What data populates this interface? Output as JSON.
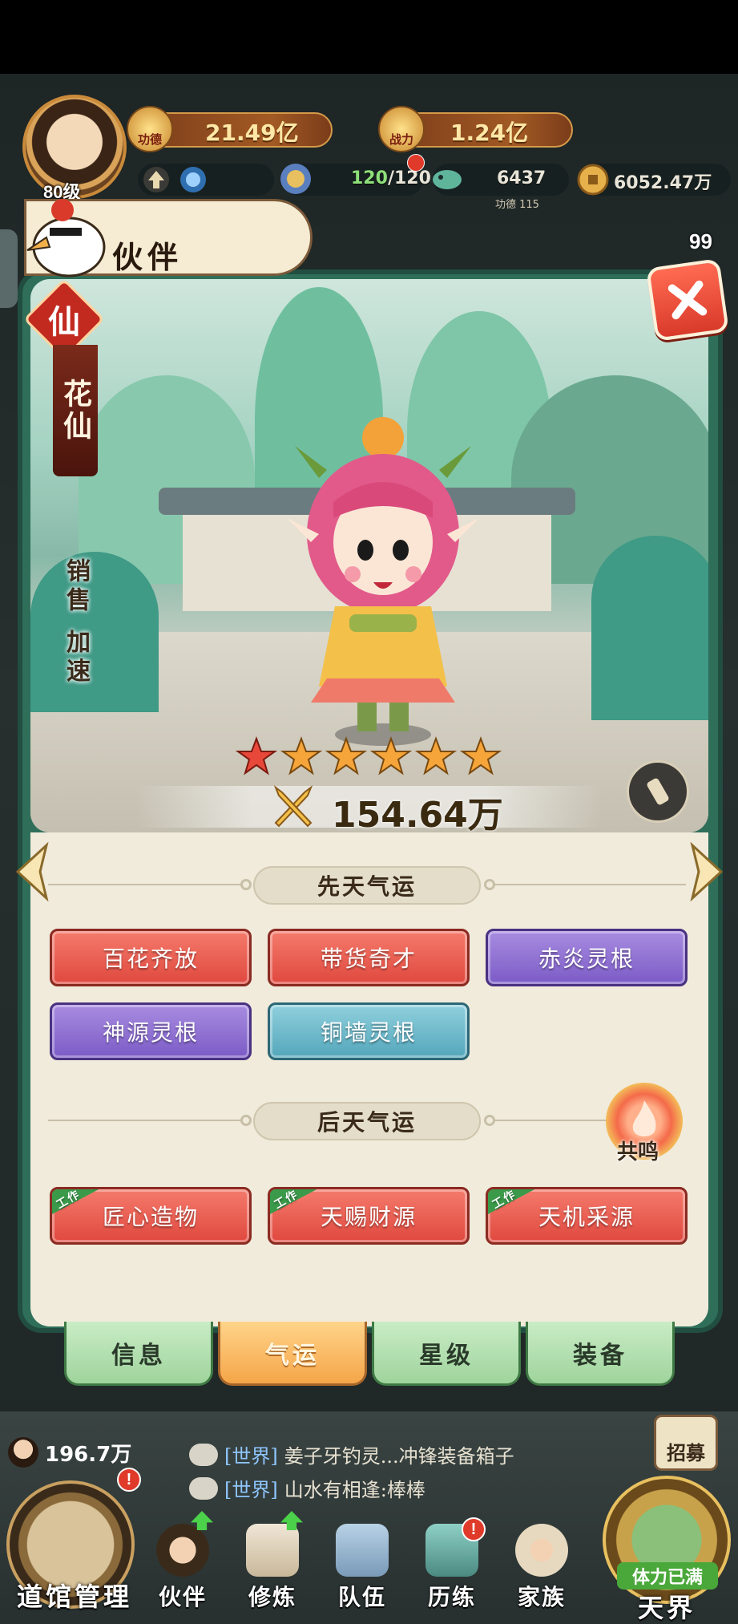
{
  "hud": {
    "level": "80级",
    "merit_label": "功德",
    "merit_value": "21.49亿",
    "power_label": "战力",
    "power_value": "1.24亿",
    "energy_value": "120",
    "energy_max": "/120",
    "jade_value": "6437",
    "merit_sub": "功德 115",
    "coin_value": "6052.47万",
    "badge_count": "99"
  },
  "header": {
    "title": "伙伴"
  },
  "partner": {
    "rank": "仙",
    "name": "花仙",
    "skill_vertical": "销售 加速",
    "stars": 6,
    "power": "154.64万"
  },
  "innate_fate": {
    "title": "先天气运",
    "items": [
      {
        "label": "百花齐放",
        "color": "red"
      },
      {
        "label": "带货奇才",
        "color": "red"
      },
      {
        "label": "赤炎灵根",
        "color": "purple"
      },
      {
        "label": "神源灵根",
        "color": "purple"
      },
      {
        "label": "铜墙灵根",
        "color": "teal"
      }
    ]
  },
  "acquired_fate": {
    "title": "后天气运",
    "resonance": "共鸣",
    "work_tag": "工作",
    "items": [
      {
        "label": "匠心造物"
      },
      {
        "label": "天赐财源"
      },
      {
        "label": "天机采源"
      }
    ]
  },
  "tabs": [
    {
      "label": "信息",
      "active": false
    },
    {
      "label": "气运",
      "active": true
    },
    {
      "label": "星级",
      "active": false
    },
    {
      "label": "装备",
      "active": false
    }
  ],
  "bottom": {
    "currency": "196.7万",
    "chat": [
      {
        "channel": "[世界]",
        "text": "姜子牙钓灵...冲锋装备箱子"
      },
      {
        "channel": "[世界]",
        "text": "山水有相逢:棒棒"
      }
    ],
    "recruit": "招募",
    "left_big": "道馆管理",
    "nav": [
      {
        "label": "伙伴"
      },
      {
        "label": "修炼"
      },
      {
        "label": "队伍"
      },
      {
        "label": "历练"
      },
      {
        "label": "家族"
      }
    ],
    "stamina": "体力已满",
    "right_big": "天界"
  },
  "colors": {
    "fate_red": "#e0483e",
    "fate_purple": "#7b5bc6",
    "fate_teal": "#54a6bb",
    "tab_active": "#f5a548",
    "tab_inactive": "#9fd49c"
  }
}
